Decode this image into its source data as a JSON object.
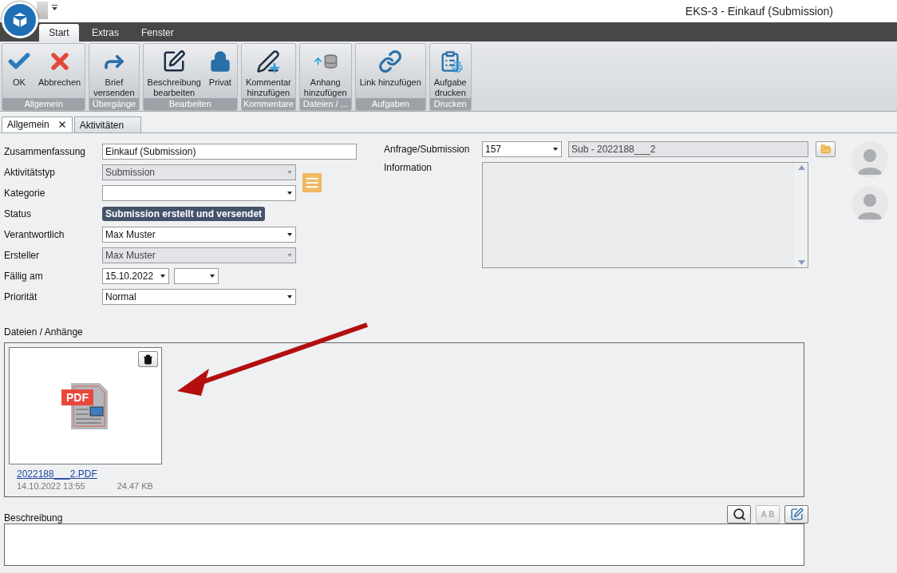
{
  "window": {
    "title": "EKS-3 - Einkauf (Submission)"
  },
  "ribbon_tabs": [
    {
      "label": "Start",
      "selected": true
    },
    {
      "label": "Extras",
      "selected": false
    },
    {
      "label": "Fenster",
      "selected": false
    }
  ],
  "ribbon_groups": [
    {
      "caption": "Allgemein",
      "buttons": [
        {
          "label": "OK",
          "kind": "check"
        },
        {
          "label": "Abbrechen",
          "kind": "cancel"
        }
      ]
    },
    {
      "caption": "Übergänge",
      "buttons": [
        {
          "label": "Brief\nversenden",
          "kind": "forward"
        }
      ]
    },
    {
      "caption": "Bearbeiten",
      "buttons": [
        {
          "label": "Beschreibung\nbearbeiten",
          "kind": "edit"
        },
        {
          "label": "Privat",
          "kind": "lock"
        }
      ]
    },
    {
      "caption": "Kommentare",
      "buttons": [
        {
          "label": "Kommentar\nhinzufügen",
          "kind": "pen"
        }
      ]
    },
    {
      "caption": "Dateien / ...",
      "buttons": [
        {
          "label": "Anhang\nhinzufügen",
          "kind": "database"
        }
      ]
    },
    {
      "caption": "Aufgaben",
      "buttons": [
        {
          "label": "Link hinzufügen",
          "kind": "link"
        }
      ]
    },
    {
      "caption": "Drucken",
      "buttons": [
        {
          "label": "Aufgabe\ndrucken",
          "kind": "print"
        }
      ]
    }
  ],
  "doc_tabs": [
    {
      "label": "Allgemein",
      "selected": true,
      "closable": true
    },
    {
      "label": "Aktivitäten",
      "selected": false,
      "closable": false
    }
  ],
  "form": [
    {
      "label": "Zusammenfassung",
      "kind": "text",
      "value": "Einkauf (Submission)",
      "disabled": false
    },
    {
      "label": "Aktivitätstyp",
      "kind": "combo",
      "value": "Submission",
      "disabled": true,
      "notes_button": true
    },
    {
      "label": "Kategorie",
      "kind": "combo",
      "disabled": false
    },
    {
      "label": "Status",
      "kind": "status",
      "value": "Submission erstellt und versendet",
      "disabled": false
    },
    {
      "label": "Verantwortlich",
      "kind": "combo",
      "value": "Max Muster",
      "disabled": false
    },
    {
      "label": "Ersteller",
      "kind": "combo",
      "value": "Max Muster",
      "disabled": true
    },
    {
      "label": "Fällig am",
      "kind": "date",
      "value": "15.10.2022",
      "disabled": false
    },
    {
      "label": "Priorität",
      "kind": "combo",
      "value": "Normal",
      "disabled": false
    }
  ],
  "request": {
    "label": "Anfrage/Submission",
    "number": "157",
    "reference": "Sub - 2022188___2"
  },
  "information": {
    "label": "Information"
  },
  "avatars": [
    {
      "kind": "person"
    },
    {
      "kind": "person"
    }
  ],
  "attachments": {
    "label": "Dateien / Anhänge",
    "files": [
      {
        "name": "2022188___2.PDF",
        "type_badge": "PDF",
        "date": "14.10.2022 13:55",
        "size": "24.47 KB"
      }
    ]
  },
  "description": {
    "label": "Beschreibung",
    "tools": [
      {
        "kind": "zoom",
        "disabled": false
      },
      {
        "kind": "replace",
        "text": "A B",
        "disabled": true
      },
      {
        "kind": "edit",
        "disabled": false
      }
    ]
  }
}
